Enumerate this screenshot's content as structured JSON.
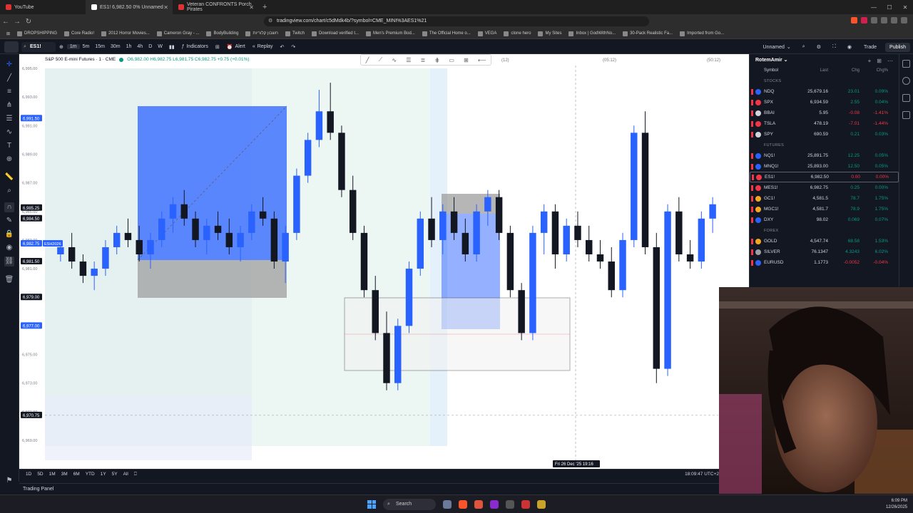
{
  "browser": {
    "tabs": [
      {
        "label": "YouTube"
      },
      {
        "label": "ES1! 6,982.50 0% Unnamed"
      },
      {
        "label": "Veteran CONFRONTS Porch Pirates"
      }
    ],
    "url": "tradingview.com/chart/c5dMdk4b/?symbol=CME_MINI%3AES1%21"
  },
  "bookmarks": [
    "DROPSHIPPING",
    "Core Radio!",
    "2012 Horror Movies...",
    "Cameron Gray - ...",
    "BodyBuilding",
    "חשבון קלוריות",
    "Twitch",
    "Download verified t...",
    "Men's Premium Bod...",
    "The Official Home o...",
    "VEGA",
    "clone hero",
    "My Sites",
    "Inbox | GodWithNo...",
    "30-Pack Realistic Fa...",
    "Imported from Go..."
  ],
  "toolbar": {
    "symbol": "ES1!",
    "timeframes": [
      "1m",
      "5m",
      "15m",
      "30m",
      "1h",
      "4h",
      "D",
      "W"
    ],
    "indicators_label": "Indicators",
    "alert_label": "Alert",
    "replay_label": "Replay",
    "layout_name": "Unnamed",
    "trade_label": "Trade",
    "publish_label": "Publish"
  },
  "chart": {
    "title": "S&P 500 E-mini Futures · 1 · CME",
    "ohlc": "O6,982.00 H6,982.75 L6,981.75 C6,982.75 +0.75 (+0.01%)",
    "session_labels": [
      "(12)",
      "(05:12)",
      "(50:12)"
    ],
    "clock": "18:09:47 UTC+2",
    "price_badges": [
      {
        "price": "6,991.50",
        "color": "#2962ff"
      },
      {
        "price": "6,985.25",
        "color": "#131722"
      },
      {
        "price": "6,984.50",
        "color": "#131722"
      },
      {
        "price": "6,982.75",
        "color": "#2962ff"
      },
      {
        "price": "6,981.50",
        "color": "#131722"
      },
      {
        "price": "6,979.00",
        "color": "#131722"
      },
      {
        "price": "6,977.00",
        "color": "#2962ff"
      },
      {
        "price": "6,970.75",
        "color": "#131722"
      }
    ],
    "current_price_tag": "ESH2026",
    "date_tag": "Fri 26 Dec '25   19:16"
  },
  "chart_data": {
    "type": "candlestick",
    "ylim": [
      6969,
      6995
    ],
    "candles": [
      [
        6982.0,
        6983.0,
        6981.5,
        6982.5
      ],
      [
        6982.5,
        6983.5,
        6981.0,
        6981.5
      ],
      [
        6981.5,
        6982.0,
        6980.0,
        6980.5
      ],
      [
        6980.5,
        6981.5,
        6979.5,
        6981.0
      ],
      [
        6981.0,
        6983.0,
        6980.5,
        6982.5
      ],
      [
        6982.5,
        6984.0,
        6982.0,
        6983.5
      ],
      [
        6983.5,
        6984.5,
        6982.5,
        6983.0
      ],
      [
        6983.0,
        6984.0,
        6981.5,
        6982.0
      ],
      [
        6982.0,
        6983.5,
        6981.0,
        6983.0
      ],
      [
        6983.0,
        6985.0,
        6982.5,
        6984.5
      ],
      [
        6984.5,
        6986.0,
        6983.5,
        6985.5
      ],
      [
        6985.5,
        6986.5,
        6984.0,
        6984.5
      ],
      [
        6984.5,
        6985.0,
        6982.5,
        6983.0
      ],
      [
        6983.0,
        6984.5,
        6982.0,
        6984.0
      ],
      [
        6984.0,
        6985.0,
        6983.0,
        6983.5
      ],
      [
        6983.5,
        6984.5,
        6982.0,
        6982.5
      ],
      [
        6982.5,
        6984.0,
        6981.5,
        6983.5
      ],
      [
        6983.5,
        6985.5,
        6983.0,
        6985.0
      ],
      [
        6985.0,
        6986.0,
        6984.0,
        6984.5
      ],
      [
        6984.5,
        6985.0,
        6981.0,
        6981.5
      ],
      [
        6981.5,
        6984.0,
        6980.0,
        6983.5
      ],
      [
        6983.5,
        6988.0,
        6983.0,
        6987.5
      ],
      [
        6987.5,
        6990.5,
        6987.0,
        6990.0
      ],
      [
        6990.0,
        6993.5,
        6989.5,
        6992.0
      ],
      [
        6992.0,
        6994.0,
        6990.0,
        6990.5
      ],
      [
        6990.5,
        6991.0,
        6986.0,
        6986.5
      ],
      [
        6986.5,
        6987.5,
        6983.0,
        6983.5
      ],
      [
        6983.5,
        6984.0,
        6979.0,
        6979.5
      ],
      [
        6979.5,
        6980.5,
        6976.0,
        6976.5
      ],
      [
        6976.5,
        6978.0,
        6972.5,
        6973.0
      ],
      [
        6973.0,
        6977.5,
        6972.5,
        6977.0
      ],
      [
        6977.0,
        6981.5,
        6976.5,
        6981.0
      ],
      [
        6981.0,
        6985.0,
        6980.5,
        6984.5
      ],
      [
        6984.5,
        6986.0,
        6982.5,
        6983.0
      ],
      [
        6983.0,
        6985.5,
        6982.0,
        6985.0
      ],
      [
        6985.0,
        6986.0,
        6983.0,
        6983.5
      ],
      [
        6983.5,
        6984.5,
        6981.5,
        6982.0
      ],
      [
        6982.0,
        6985.5,
        6981.5,
        6985.0
      ],
      [
        6985.0,
        6986.5,
        6984.0,
        6986.0
      ],
      [
        6986.0,
        6986.5,
        6983.0,
        6983.5
      ],
      [
        6983.5,
        6984.0,
        6979.0,
        6979.5
      ],
      [
        6979.5,
        6980.0,
        6976.0,
        6976.5
      ],
      [
        6976.5,
        6984.0,
        6976.0,
        6983.5
      ],
      [
        6983.5,
        6985.5,
        6982.0,
        6985.0
      ],
      [
        6985.0,
        6985.5,
        6981.0,
        6982.0
      ],
      [
        6982.0,
        6984.5,
        6981.5,
        6984.0
      ],
      [
        6984.0,
        6985.0,
        6982.5,
        6983.0
      ],
      [
        6983.0,
        6984.0,
        6981.5,
        6982.0
      ],
      [
        6982.0,
        6983.0,
        6981.0,
        6981.5
      ],
      [
        6981.5,
        6982.5,
        6979.0,
        6979.5
      ],
      [
        6979.5,
        6983.5,
        6979.0,
        6983.0
      ],
      [
        6983.0,
        6991.0,
        6982.5,
        6990.5
      ],
      [
        6990.5,
        6992.0,
        6982.0,
        6982.5
      ],
      [
        6982.5,
        6983.5,
        6973.0,
        6974.0
      ],
      [
        6974.0,
        6985.5,
        6973.5,
        6985.0
      ],
      [
        6985.0,
        6986.0,
        6981.5,
        6982.0
      ],
      [
        6982.0,
        6983.0,
        6981.0,
        6981.5
      ],
      [
        6981.5,
        6985.0,
        6981.0,
        6984.5
      ],
      [
        6984.5,
        6986.0,
        6983.5,
        6985.5
      ]
    ]
  },
  "ranges": [
    "1D",
    "5D",
    "1M",
    "3M",
    "6M",
    "YTD",
    "1Y",
    "5Y",
    "All"
  ],
  "panel": {
    "label": "Trading Panel"
  },
  "watchlist": {
    "title": "RotemAmir",
    "columns": [
      "Symbol",
      "Last",
      "Chg",
      "Chg%"
    ],
    "sections": [
      {
        "name": "STOCKS",
        "rows": [
          {
            "sym": "NDQ",
            "last": "25,679.16",
            "chg": "23.01",
            "pct": "0.09%",
            "dir": "up",
            "color": "#2962ff"
          },
          {
            "sym": "SPX",
            "last": "6,934.59",
            "chg": "2.55",
            "pct": "0.04%",
            "dir": "up",
            "color": "#f23645"
          },
          {
            "sym": "BBAI",
            "last": "5.95",
            "chg": "-0.08",
            "pct": "-1.41%",
            "dir": "dn",
            "color": "#d1d4dc"
          },
          {
            "sym": "TSLA",
            "last": "478.19",
            "chg": "-7.01",
            "pct": "-1.44%",
            "dir": "dn",
            "color": "#f23645"
          },
          {
            "sym": "SPY",
            "last": "690.59",
            "chg": "0.21",
            "pct": "0.03%",
            "dir": "up",
            "color": "#d1d4dc"
          }
        ]
      },
      {
        "name": "FUTURES",
        "rows": [
          {
            "sym": "NQ1!",
            "last": "25,891.75",
            "chg": "12.25",
            "pct": "0.05%",
            "dir": "up",
            "color": "#2962ff"
          },
          {
            "sym": "MNQ1!",
            "last": "25,893.00",
            "chg": "12.50",
            "pct": "0.05%",
            "dir": "up",
            "color": "#2962ff"
          },
          {
            "sym": "ES1!",
            "last": "6,982.50",
            "chg": "0.00",
            "pct": "0.00%",
            "dir": "dn",
            "color": "#f23645",
            "selected": true
          },
          {
            "sym": "MES1!",
            "last": "6,982.75",
            "chg": "0.25",
            "pct": "0.00%",
            "dir": "up",
            "color": "#f23645"
          },
          {
            "sym": "GC1!",
            "last": "4,581.5",
            "chg": "78.7",
            "pct": "1.75%",
            "dir": "up",
            "color": "#f5a623"
          },
          {
            "sym": "MGC1!",
            "last": "4,581.7",
            "chg": "78.9",
            "pct": "1.75%",
            "dir": "up",
            "color": "#f5a623"
          },
          {
            "sym": "DXY",
            "last": "98.02",
            "chg": "0.069",
            "pct": "0.07%",
            "dir": "up",
            "color": "#2962ff"
          }
        ]
      },
      {
        "name": "FOREX",
        "rows": [
          {
            "sym": "GOLD",
            "last": "4,547.74",
            "chg": "68.58",
            "pct": "1.53%",
            "dir": "up",
            "color": "#f5a623"
          },
          {
            "sym": "SILVER",
            "last": "76.1347",
            "chg": "4.3243",
            "pct": "6.02%",
            "dir": "up",
            "color": "#9aa0a6"
          },
          {
            "sym": "EURUSD",
            "last": "1.1773",
            "chg": "-0.0052",
            "pct": "-0.04%",
            "dir": "dn",
            "color": "#2962ff"
          }
        ]
      }
    ]
  },
  "taskbar": {
    "search_label": "Search",
    "time": "6:09 PM",
    "date": "12/26/2025"
  }
}
